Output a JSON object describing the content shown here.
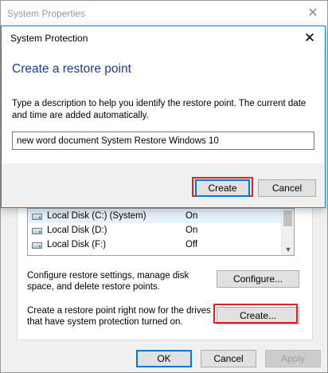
{
  "outer": {
    "title": "System Properties",
    "drives": [
      {
        "name": "Local Disk (C:) (System)",
        "status": "On"
      },
      {
        "name": "Local Disk (D:)",
        "status": "On"
      },
      {
        "name": "Local Disk (F:)",
        "status": "Off"
      }
    ],
    "configure_text": "Configure restore settings, manage disk space, and delete restore points.",
    "configure_label": "Configure...",
    "create_text": "Create a restore point right now for the drives that have system protection turned on.",
    "create_label": "Create...",
    "ok_label": "OK",
    "cancel_label": "Cancel",
    "apply_label": "Apply"
  },
  "dialog": {
    "title": "System Protection",
    "heading": "Create a restore point",
    "description": "Type a description to help you identify the restore point. The current date and time are added automatically.",
    "input_value": "new word document System Restore Windows 10",
    "create_label": "Create",
    "cancel_label": "Cancel"
  },
  "colors": {
    "highlight": "#e02020",
    "accent": "#0078d7",
    "heading": "#1a3d8f"
  }
}
